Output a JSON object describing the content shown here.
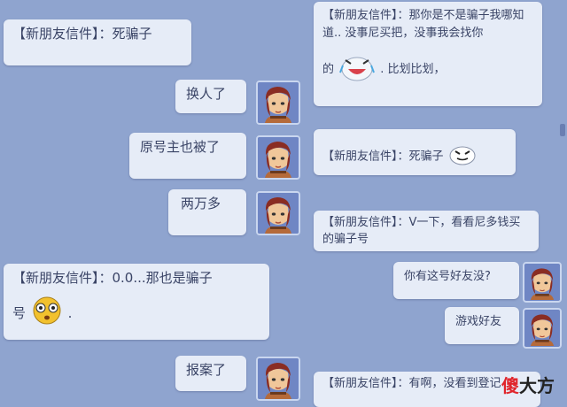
{
  "messages": {
    "m1_left": "【新朋友信件】：死骗子",
    "m2_right_line1": "【新朋友信件】：那你是不是骗子我哪知道.. 没事尼买把，没事我会找你",
    "m2_right_line2a": "的",
    "m2_right_line2b": ". 比划比划，",
    "m3_self": "换人了",
    "m4_self": "原号主也被了",
    "m5_right": "【新朋友信件】：死骗子",
    "m6_self": "两万多",
    "m7_right": "【新朋友信件】：V一下，看看尼多钱买的骗子号",
    "m8_left_line1": "【新朋友信件】：0.0...那也是骗子",
    "m8_left_line2a": "号",
    "m8_left_line2b": ".",
    "m9_self": "你有这号好友没?",
    "m10_self": "游戏好友",
    "m11_self": "报案了",
    "m12_right": "【新朋友信件】：有啊，没看到登记"
  },
  "watermark": {
    "part1": "傻",
    "part2": "大方"
  },
  "icons": {
    "laugh": "laughing-emoji-icon",
    "smirk": "smirk-emoji-icon",
    "shocked": "shocked-emoji-icon",
    "avatar": "player-avatar"
  },
  "colors": {
    "background": "#8fa4cf",
    "bubble": "#e6ecf7",
    "watermark_red": "#e0242b"
  }
}
